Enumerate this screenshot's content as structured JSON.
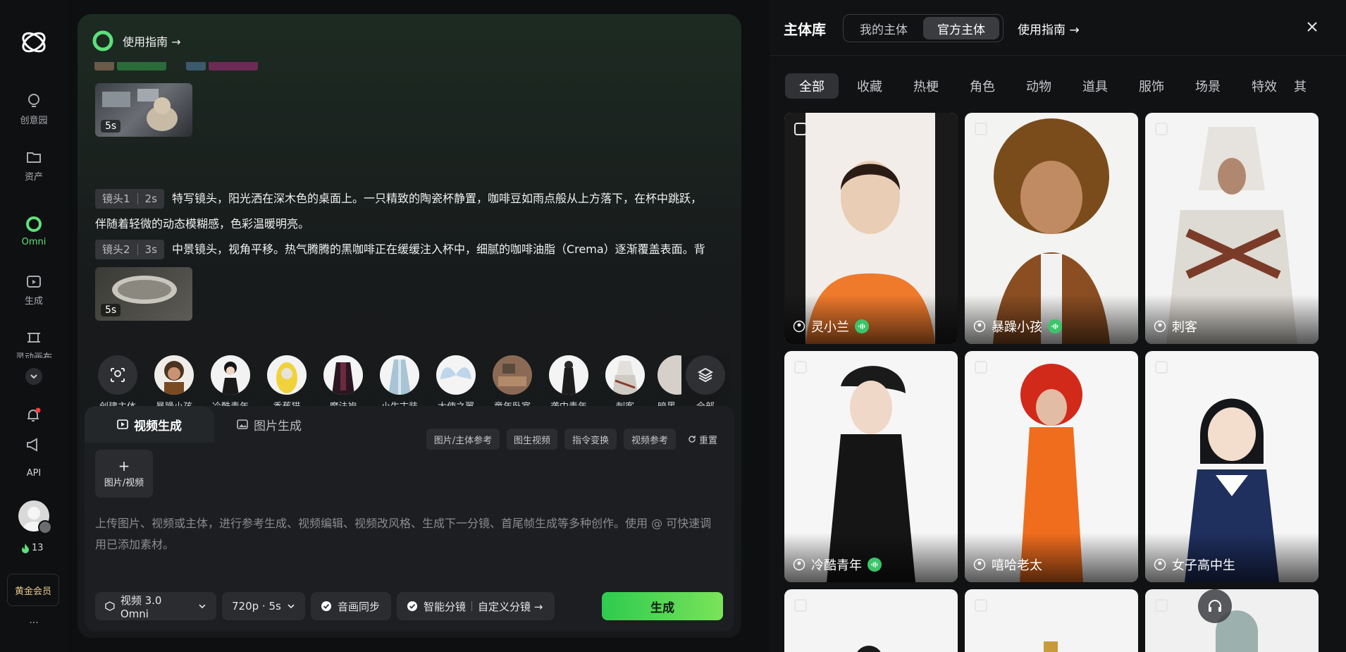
{
  "sidebar": {
    "items": [
      {
        "label": "创意园",
        "icon": "lightbulb-icon"
      },
      {
        "label": "资产",
        "icon": "folder-icon"
      },
      {
        "label": "Omni",
        "icon": "omni-icon"
      },
      {
        "label": "生成",
        "icon": "generate-icon"
      },
      {
        "label": "灵动画布",
        "icon": "canvas-icon"
      }
    ],
    "api_label": "API",
    "points": "13",
    "member_label": "黄金会员",
    "more_label": "···"
  },
  "main": {
    "guide_label": "使用指南 →",
    "shots": [
      {
        "tag": "镜头1",
        "duration": "2s",
        "text_line1": "特写镜头，阳光洒在深木色的桌面上。一只精致的陶瓷杯静置，咖啡豆如雨点般从上方落下，在杯中跳跃，",
        "text_line2": "伴随着轻微的动态模糊感，色彩温暖明亮。"
      },
      {
        "tag": "镜头2",
        "duration": "3s",
        "text_line1": "中景镜头，视角平移。热气腾腾的黑咖啡正在缓缓注入杯中，细腻的咖啡油脂（Crema）逐渐覆盖表面。背"
      }
    ],
    "thumb1_duration": "5s",
    "thumb2_duration": "5s",
    "subjects": [
      "创建主体",
      "暴躁小孩",
      "冷酷青年",
      "香蕉猫",
      "魔法袍",
      "小生古装",
      "大使之翼",
      "童年卧室",
      "袭中青年",
      "刺客",
      "暗黑"
    ],
    "all_label": "全部",
    "tabs": {
      "video": "视频生成",
      "image": "图片生成"
    },
    "chips": [
      "图片/主体参考",
      "图生视频",
      "指令变换",
      "视频参考"
    ],
    "reset_label": "重置",
    "upload_label": "图片/视频",
    "prompt_placeholder_line1": "上传图片、视频或主体，进行参考生成、视频编辑、视频改风格、生成下一分镜、首尾帧生成等多种创作。使用 @ 可快速调",
    "prompt_placeholder_line2": "用已添加素材。",
    "model_label": "视频 3.0 Omni",
    "res_label": "720p · 5s",
    "audio_sync_label": "音画同步",
    "smart_split_label": "智能分镜",
    "custom_split_label": "自定义分镜 →",
    "generate_label": "生成"
  },
  "library": {
    "title": "主体库",
    "tabs": [
      "我的主体",
      "官方主体"
    ],
    "active_tab": 1,
    "guide_label": "使用指南 →",
    "categories": [
      "全部",
      "收藏",
      "热梗",
      "角色",
      "动物",
      "道具",
      "服饰",
      "场景",
      "特效",
      "其"
    ],
    "cards": [
      {
        "name": "灵小兰",
        "voice": true
      },
      {
        "name": "暴躁小孩",
        "voice": true
      },
      {
        "name": "刺客",
        "voice": false
      },
      {
        "name": "冷酷青年",
        "voice": true
      },
      {
        "name": "嘻哈老太",
        "voice": false
      },
      {
        "name": "女子高中生",
        "voice": false
      }
    ]
  },
  "colors": {
    "accent": "#5ee07a",
    "generate": "#3cd05a",
    "notify": "#ff3b3b"
  }
}
